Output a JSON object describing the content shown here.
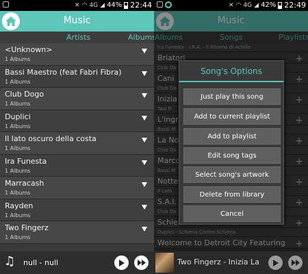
{
  "left": {
    "status": {
      "signal": "4G",
      "battery": "44%",
      "time": "22:44"
    },
    "title": "Music",
    "tabs": {
      "active": "Artists",
      "next": "Albums"
    },
    "artists": [
      {
        "name": "<Unknown>",
        "albums": "1 Albums"
      },
      {
        "name": "Bassi Maestro (feat Fabri Fibra)",
        "albums": "1 Albums"
      },
      {
        "name": "Club Dogo",
        "albums": "1 Albums"
      },
      {
        "name": "Duplici",
        "albums": "1 Albums"
      },
      {
        "name": "Il lato oscuro della costa",
        "albums": "1 Albums"
      },
      {
        "name": "Ira Funesta",
        "albums": "1 Albums"
      },
      {
        "name": "Marracash",
        "albums": "1 Albums"
      },
      {
        "name": "Rayden",
        "albums": "1 Albums"
      },
      {
        "name": "Two Fingerz",
        "albums": "1 Albums"
      }
    ],
    "player": {
      "now_playing": "null - null"
    }
  },
  "right": {
    "status": {
      "signal": "4G",
      "battery": "42%",
      "time": "22:49"
    },
    "title": "Music",
    "tabs": {
      "prev": "Albums",
      "active": "Songs",
      "next": "Playlists"
    },
    "list": [
      {
        "kind": "sub",
        "text": "Ira Funesta - I.R.A. - Il Ritorno di Achille"
      },
      {
        "kind": "title",
        "text": "Briatori"
      },
      {
        "kind": "sub",
        "text": "Club Do"
      },
      {
        "kind": "title",
        "text": "Cani"
      },
      {
        "kind": "sub",
        "text": "Club Do"
      },
      {
        "kind": "title",
        "text": "Inizia"
      },
      {
        "kind": "sub",
        "text": "Two Fi"
      },
      {
        "kind": "title",
        "text": "L'ingr"
      },
      {
        "kind": "sub",
        "text": "Bassi M"
      },
      {
        "kind": "title",
        "text": "La No"
      },
      {
        "kind": "sub",
        "text": "Club Do"
      },
      {
        "kind": "title",
        "text": "Marco"
      },
      {
        "kind": "sub",
        "text": "Bassi M"
      },
      {
        "kind": "title",
        "text": "Notte"
      },
      {
        "kind": "sub",
        "text": "Il Lato"
      },
      {
        "kind": "title",
        "text": "S.A.I."
      },
      {
        "kind": "sub",
        "text": "Club Do"
      },
      {
        "kind": "title",
        "text": "Schiena Contro Schiena"
      },
      {
        "kind": "sub",
        "text": "Duplici - Schiena Contro Schiena"
      },
      {
        "kind": "title",
        "text": "Welcome to Detroit City Featuring"
      }
    ],
    "dialog": {
      "title": "Song's Options",
      "options": [
        "Just play this song",
        "Add to current playlist",
        "Add to playlist",
        "Edit song tags",
        "Select song's artwork",
        "Delete from library",
        "Cancel"
      ]
    },
    "player": {
      "now_playing": "Two Fingerz - Inizia La"
    }
  },
  "colors": {
    "accent": "#5cc6b8",
    "background": "#3a3a3a"
  }
}
